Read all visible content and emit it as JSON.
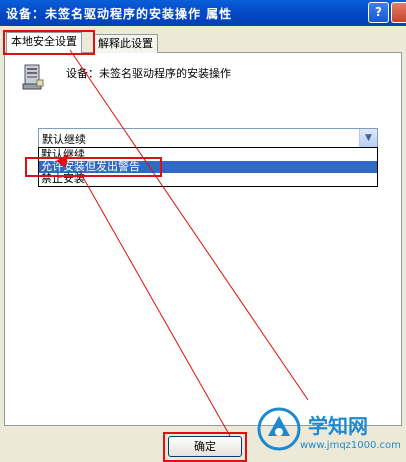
{
  "window": {
    "title": "设备：未签名驱动程序的安装操作 属性",
    "help_label": "?"
  },
  "tabs": [
    {
      "label": "本地安全设置",
      "active": true
    },
    {
      "label": "解释此设置",
      "active": false
    }
  ],
  "device": {
    "label": "设备：未签名驱动程序的安装操作",
    "icon": "computer-icon"
  },
  "dropdown": {
    "selected": "默认继续",
    "options": [
      "默认继续",
      "允许安装但发出警告",
      "禁止安装"
    ],
    "highlighted_index": 1
  },
  "buttons": {
    "ok_label": "确定"
  },
  "watermark": {
    "title": "学知网",
    "url": "www.jmqz1000.com"
  },
  "colors": {
    "annotation": "#DD1111",
    "title_bar": "#0A5FD8",
    "selection": "#316AC5"
  }
}
